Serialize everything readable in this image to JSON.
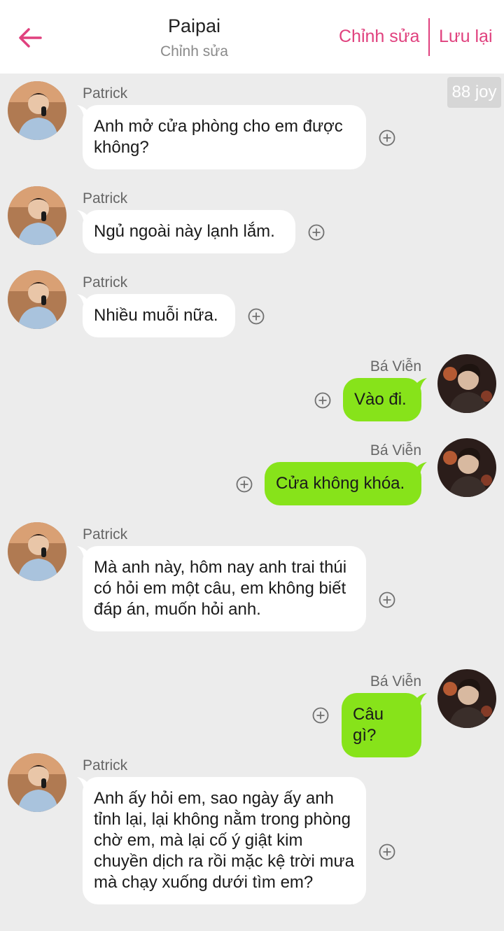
{
  "header": {
    "title": "Paipai",
    "subtitle": "Chỉnh sửa",
    "edit_label": "Chỉnh sửa",
    "save_label": "Lưu lại",
    "accent_color": "#e0417e"
  },
  "watermark": "88 joy",
  "participants": {
    "left": {
      "name": "Patrick",
      "bubble_color": "#ffffff"
    },
    "right": {
      "name": "Bá Viễn",
      "bubble_color": "#87e31a"
    }
  },
  "messages": [
    {
      "sender": "Patrick",
      "side": "left",
      "text": "Anh mở cửa phòng cho em được không?"
    },
    {
      "sender": "Patrick",
      "side": "left",
      "text": "Ngủ ngoài này lạnh lắm."
    },
    {
      "sender": "Patrick",
      "side": "left",
      "text": "Nhiều muỗi nữa."
    },
    {
      "sender": "Bá Viễn",
      "side": "right",
      "text": "Vào đi."
    },
    {
      "sender": "Bá Viễn",
      "side": "right",
      "text": "Cửa không khóa."
    },
    {
      "sender": "Patrick",
      "side": "left",
      "text": "Mà anh này, hôm nay anh trai thúi có hỏi em một câu, em không biết đáp án, muốn hỏi anh."
    },
    {
      "sender": "Bá Viễn",
      "side": "right",
      "text": "Câu gì?"
    },
    {
      "sender": "Patrick",
      "side": "left",
      "text": "Anh ấy hỏi em, sao ngày ấy anh tỉnh lại, lại không nằm trong phòng chờ em, mà lại cố ý giật kim chuyền dịch ra rồi mặc kệ trời mưa mà chạy xuống dưới tìm em?"
    }
  ]
}
